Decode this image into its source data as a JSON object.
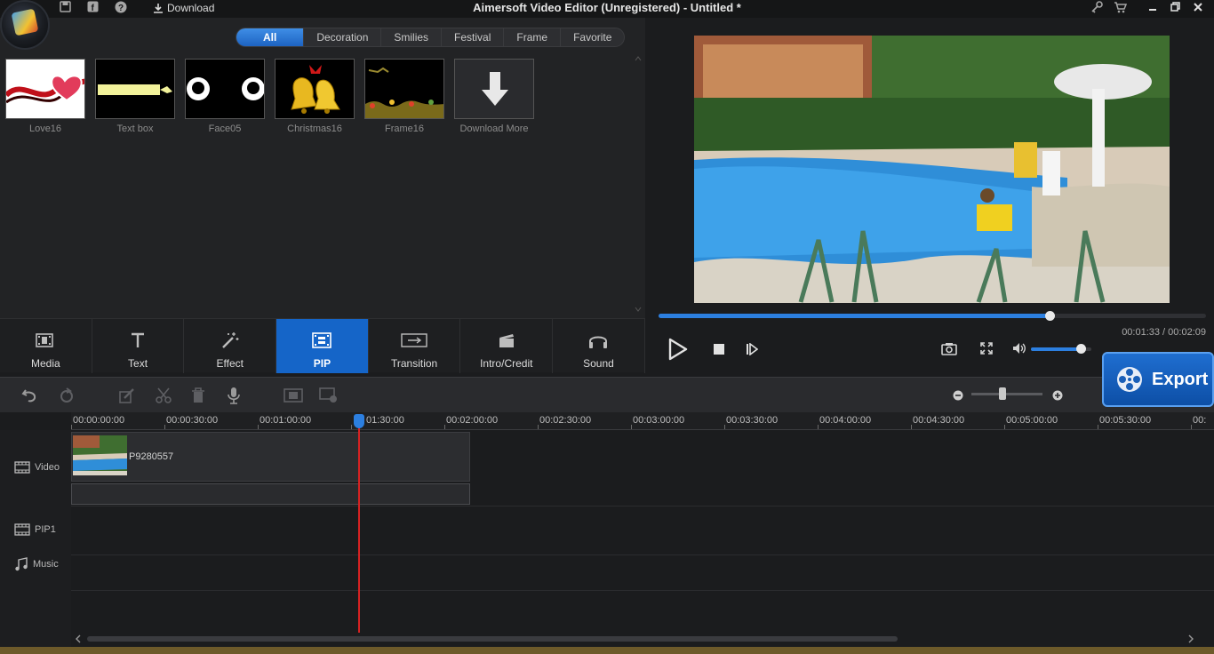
{
  "window": {
    "title": "Aimersoft Video Editor (Unregistered) - Untitled *",
    "download_label": "Download"
  },
  "filters": {
    "tabs": [
      "All",
      "Decoration",
      "Smilies",
      "Festival",
      "Frame",
      "Favorite"
    ],
    "active": "All"
  },
  "library": {
    "items": [
      {
        "label": "Love16"
      },
      {
        "label": "Text box"
      },
      {
        "label": "Face05"
      },
      {
        "label": "Christmas16"
      },
      {
        "label": "Frame16"
      },
      {
        "label": "Download More"
      }
    ]
  },
  "categories": {
    "items": [
      {
        "label": "Media",
        "icon": "film-icon"
      },
      {
        "label": "Text",
        "icon": "text-icon"
      },
      {
        "label": "Effect",
        "icon": "magic-wand-icon"
      },
      {
        "label": "PIP",
        "icon": "pip-icon"
      },
      {
        "label": "Transition",
        "icon": "transition-icon"
      },
      {
        "label": "Intro/Credit",
        "icon": "clapperboard-icon"
      },
      {
        "label": "Sound",
        "icon": "headphones-icon"
      }
    ],
    "active": "PIP"
  },
  "player": {
    "time_readout": "00:01:33 / 00:02:09",
    "progress_fraction": 0.715,
    "volume_fraction": 0.82
  },
  "export": {
    "label": "Export"
  },
  "ruler": {
    "labels": [
      "00:00:00:00",
      "00:00:30:00",
      "00:01:00:00",
      "01:30:00",
      "00:02:00:00",
      "00:02:30:00",
      "00:03:00:00",
      "00:03:30:00",
      "00:04:00:00",
      "00:04:30:00",
      "00:05:00:00",
      "00:05:30:00",
      "00:"
    ]
  },
  "tracks": {
    "video_label": "Video",
    "pip_label": "PIP1",
    "music_label": "Music",
    "clip_name": "P9280557"
  },
  "colors": {
    "accent": "#1565c8",
    "playhead": "#d62222",
    "progress": "#2c7fe0"
  }
}
